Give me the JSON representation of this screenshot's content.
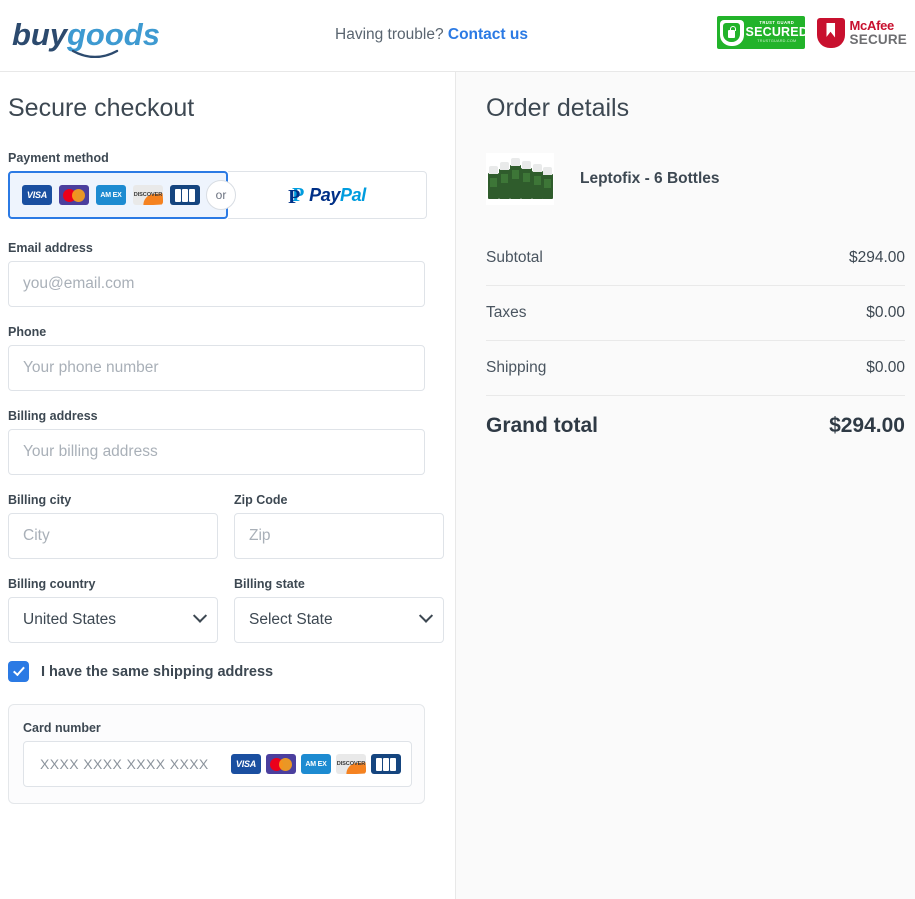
{
  "header": {
    "logo_part1": "buy",
    "logo_part2": "goods",
    "trouble_text": "Having trouble?",
    "contact_link": "Contact us",
    "badges": {
      "trustguard": {
        "top": "TRUST GUARD",
        "main": "SECURED",
        "bottom": "TRUSTGUARD.COM"
      },
      "mcafee": {
        "line1": "McAfee",
        "line2": "SECURE"
      }
    }
  },
  "checkout": {
    "title": "Secure checkout",
    "payment_method_label": "Payment method",
    "or_text": "or",
    "card_brands": [
      "VISA",
      "Mastercard",
      "AMEX",
      "DISCOVER",
      "JCB"
    ],
    "paypal": {
      "pay": "Pay",
      "pal": "Pal"
    },
    "fields": {
      "email": {
        "label": "Email address",
        "placeholder": "you@email.com",
        "value": ""
      },
      "phone": {
        "label": "Phone",
        "placeholder": "Your phone number",
        "value": ""
      },
      "billing_address": {
        "label": "Billing address",
        "placeholder": "Your billing address",
        "value": ""
      },
      "billing_city": {
        "label": "Billing city",
        "placeholder": "City",
        "value": ""
      },
      "zip_code": {
        "label": "Zip Code",
        "placeholder": "Zip",
        "value": ""
      },
      "billing_country": {
        "label": "Billing country",
        "value": "United States"
      },
      "billing_state": {
        "label": "Billing state",
        "value": "Select State"
      }
    },
    "same_shipping_label": "I have the same shipping address",
    "card_section": {
      "label": "Card number",
      "placeholder": "XXXX XXXX XXXX XXXX",
      "value": ""
    }
  },
  "order": {
    "title": "Order details",
    "product_name": "Leptofix - 6 Bottles",
    "lines": [
      {
        "label": "Subtotal",
        "amount": "$294.00"
      },
      {
        "label": "Taxes",
        "amount": "$0.00"
      },
      {
        "label": "Shipping",
        "amount": "$0.00"
      }
    ],
    "grand_total_label": "Grand total",
    "grand_total_amount": "$294.00"
  },
  "colors": {
    "accent": "#2b7ae4",
    "logo_dark": "#2c4a6e",
    "logo_light": "#3e9ad1",
    "trustguard_green": "#22b32a",
    "mcafee_red": "#c8102e",
    "panel_bg": "#fafafa"
  }
}
